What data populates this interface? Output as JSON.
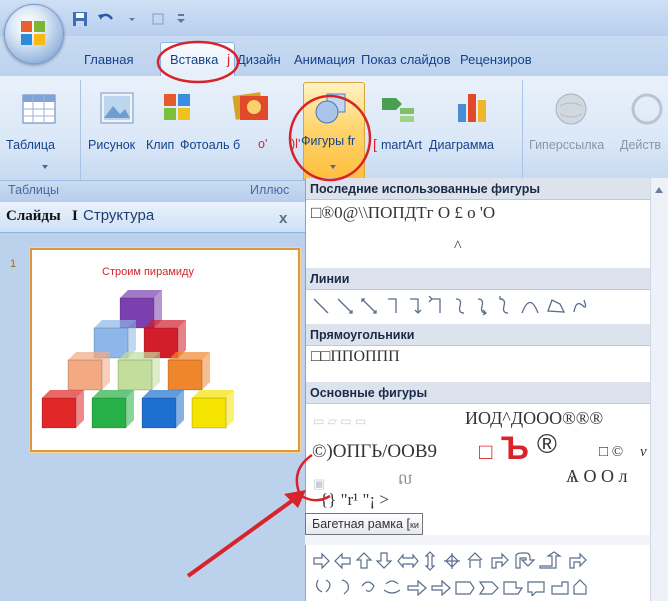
{
  "tabs": [
    "Главная",
    "Вставка",
    "j",
    "Дизайн",
    "Анимация",
    "Показ слайдов",
    "Рецензиров"
  ],
  "ribbon": {
    "table_label": "Таблица",
    "picture_label": "Рисунок",
    "clip_label": "Клип",
    "photo_label": "Фотоаль б",
    "photo_extra": "o'",
    "shapes_prefix": ")l'",
    "shapes_label": "Фигуры fr",
    "smartart_bracket": "[",
    "smartart_label": "martArt",
    "chart_label": "Диаграмма",
    "hyperlink_label": "Гиперссылка",
    "action_label": "Действ"
  },
  "groups": {
    "tables": "Таблицы",
    "illus": "Иллюс"
  },
  "left_panel": {
    "tab_slides": "Слайды",
    "separator": "I",
    "tab_outline": "Структура",
    "close_glyph": "x",
    "slide_number": "1",
    "slide_title": "Строим пирамиду"
  },
  "gallery": {
    "recent_header": "Последние использованные фигуры",
    "recent_row": "□®0@\\\\ПОПДТг О £ о 'О",
    "recent_row2": "^",
    "lines_header": "Линии",
    "rect_header": "Прямоугольники",
    "rect_row": "□□ППОППП",
    "basic_header": "Основные фигуры",
    "basic_row1": "ИОД^ДООО®®®",
    "basic_row2a": "©)ОПГЬ/ООВ9",
    "basic_row2b": "□",
    "basic_row2c": "Ъ",
    "basic_row2d": "®",
    "basic_row2e": "□ ©",
    "basic_row2f": "v",
    "basic_row3": "Ѧ О О л",
    "basic_row4a": "ល",
    "basic_row4": "{} \"r¹ \"¡ >",
    "tooltip": "Багетная рамка [",
    "tooltip_small": "ки"
  },
  "colors": {
    "accent": "#15428b",
    "annotation_red": "#d8232a",
    "cube_red": "#e12727",
    "cube_green": "#27b046",
    "cube_blue": "#1f6fd0",
    "cube_yellow": "#f5e400",
    "cube_salmon": "#f3a982",
    "cube_lightgreen": "#c2dd9c",
    "cube_orange": "#f0862b",
    "cube_lightblue": "#8db7e8",
    "cube_purple": "#7b3fb0",
    "cube_darkred": "#d21e2a"
  }
}
